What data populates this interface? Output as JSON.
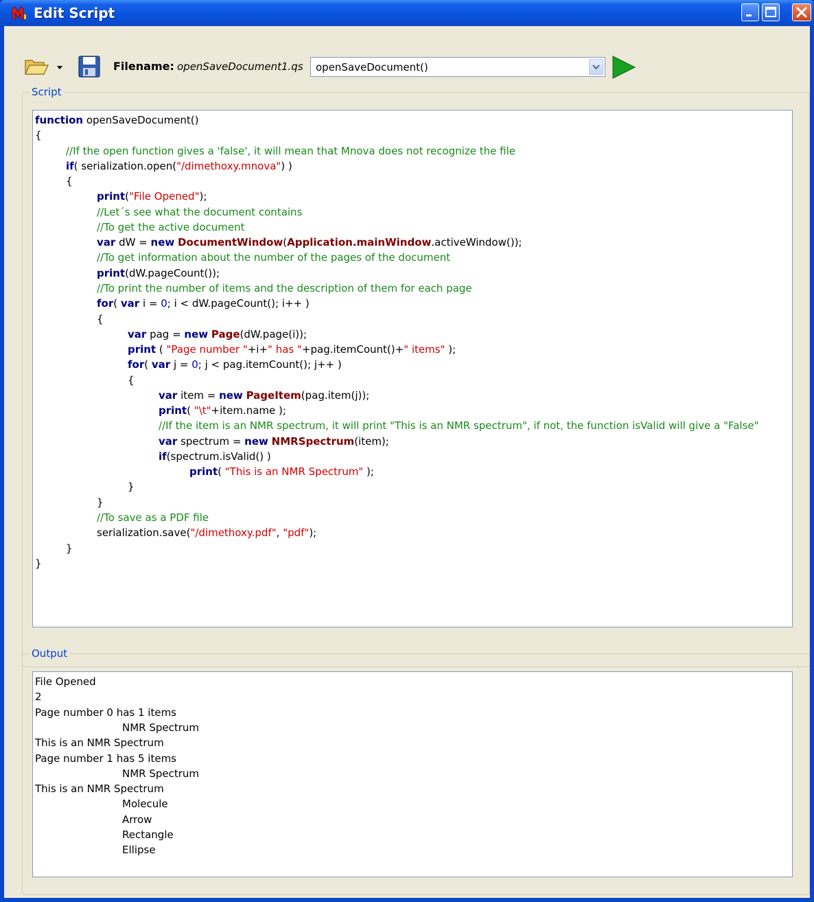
{
  "window": {
    "title": "Edit Script",
    "colors": {
      "titlebar": "#0a52dd",
      "face": "#ece9d8",
      "group_label": "#0046d5"
    }
  },
  "toolbar": {
    "open_icon": "folder-open-icon",
    "dropdown_icon": "chevron-down-icon",
    "save_icon": "floppy-disk-icon",
    "filename_label": "Filename:",
    "filename_value": "openSaveDocument1.qs",
    "function_selected": "openSaveDocument()",
    "run_icon": "play-icon"
  },
  "script": {
    "group_label": "Script",
    "colors": {
      "keyword": "#00007f",
      "class": "#7f0000",
      "string": "#d40000",
      "comment": "#1a8a1a",
      "number": "#0000c0"
    },
    "lines": [
      {
        "indent": 0,
        "tokens": [
          [
            "k",
            "function"
          ],
          [
            "t",
            " openSaveDocument()"
          ]
        ]
      },
      {
        "indent": 0,
        "tokens": [
          [
            "t",
            "{"
          ]
        ]
      },
      {
        "indent": 1,
        "tokens": [
          [
            "c",
            "//If the open function gives a 'false', it will mean that Mnova does not recognize the file"
          ]
        ]
      },
      {
        "indent": 1,
        "tokens": [
          [
            "k",
            "if"
          ],
          [
            "t",
            "( serialization.open("
          ],
          [
            "s",
            "\"/dimethoxy.mnova\""
          ],
          [
            "t",
            ") )"
          ]
        ]
      },
      {
        "indent": 1,
        "tokens": [
          [
            "t",
            "{"
          ]
        ]
      },
      {
        "indent": 2,
        "tokens": [
          [
            "k",
            "print"
          ],
          [
            "t",
            "("
          ],
          [
            "s",
            "\"File Opened\""
          ],
          [
            "t",
            ");"
          ]
        ]
      },
      {
        "indent": 2,
        "tokens": [
          [
            "c",
            "//Let´s see what the document contains"
          ]
        ]
      },
      {
        "indent": 2,
        "tokens": [
          [
            "c",
            "//To get the active document"
          ]
        ]
      },
      {
        "indent": 2,
        "tokens": [
          [
            "k",
            "var"
          ],
          [
            "t",
            " dW = "
          ],
          [
            "k",
            "new"
          ],
          [
            "t",
            " "
          ],
          [
            "x",
            "DocumentWindow"
          ],
          [
            "t",
            "("
          ],
          [
            "x",
            "Application.mainWindow"
          ],
          [
            "t",
            ".activeWindow());"
          ]
        ]
      },
      {
        "indent": 2,
        "tokens": [
          [
            "c",
            "//To get information about the number of the pages of the document"
          ]
        ]
      },
      {
        "indent": 2,
        "tokens": [
          [
            "k",
            "print"
          ],
          [
            "t",
            "(dW.pageCount());"
          ]
        ]
      },
      {
        "indent": 2,
        "tokens": [
          [
            "c",
            "//To print the number of items and the description of them for each page"
          ]
        ]
      },
      {
        "indent": 2,
        "tokens": [
          [
            "k",
            "for"
          ],
          [
            "t",
            "( "
          ],
          [
            "k",
            "var"
          ],
          [
            "t",
            " i = "
          ],
          [
            "n",
            "0"
          ],
          [
            "t",
            "; i < dW.pageCount(); i++ )"
          ]
        ]
      },
      {
        "indent": 2,
        "tokens": [
          [
            "t",
            "{"
          ]
        ]
      },
      {
        "indent": 3,
        "tokens": [
          [
            "k",
            "var"
          ],
          [
            "t",
            " pag = "
          ],
          [
            "k",
            "new"
          ],
          [
            "t",
            " "
          ],
          [
            "x",
            "Page"
          ],
          [
            "t",
            "(dW.page(i));"
          ]
        ]
      },
      {
        "indent": 3,
        "tokens": [
          [
            "k",
            "print"
          ],
          [
            "t",
            " ( "
          ],
          [
            "s",
            "\"Page number \""
          ],
          [
            "t",
            "+i+"
          ],
          [
            "s",
            "\" has \""
          ],
          [
            "t",
            "+pag.itemCount()+"
          ],
          [
            "s",
            "\" items\""
          ],
          [
            "t",
            " );"
          ]
        ]
      },
      {
        "indent": 3,
        "tokens": [
          [
            "k",
            "for"
          ],
          [
            "t",
            "( "
          ],
          [
            "k",
            "var"
          ],
          [
            "t",
            " j = "
          ],
          [
            "n",
            "0"
          ],
          [
            "t",
            "; j < pag.itemCount(); j++ )"
          ]
        ]
      },
      {
        "indent": 3,
        "tokens": [
          [
            "t",
            "{"
          ]
        ]
      },
      {
        "indent": 4,
        "tokens": [
          [
            "k",
            "var"
          ],
          [
            "t",
            " item = "
          ],
          [
            "k",
            "new"
          ],
          [
            "t",
            " "
          ],
          [
            "x",
            "PageItem"
          ],
          [
            "t",
            "(pag.item(j));"
          ]
        ]
      },
      {
        "indent": 4,
        "tokens": [
          [
            "k",
            "print"
          ],
          [
            "t",
            "( "
          ],
          [
            "s",
            "\"\\t\""
          ],
          [
            "t",
            "+item.name );"
          ]
        ]
      },
      {
        "indent": 4,
        "tokens": [
          [
            "c",
            "//If the item is an NMR spectrum, it will print \"This is an NMR spectrum\", if not, the function isValid will give a \"False\""
          ]
        ]
      },
      {
        "indent": 4,
        "tokens": [
          [
            "k",
            "var"
          ],
          [
            "t",
            " spectrum = "
          ],
          [
            "k",
            "new"
          ],
          [
            "t",
            " "
          ],
          [
            "x",
            "NMRSpectrum"
          ],
          [
            "t",
            "(item);"
          ]
        ]
      },
      {
        "indent": 4,
        "tokens": [
          [
            "k",
            "if"
          ],
          [
            "t",
            "(spectrum.isValid() )"
          ]
        ]
      },
      {
        "indent": 5,
        "tokens": [
          [
            "k",
            "print"
          ],
          [
            "t",
            "( "
          ],
          [
            "s",
            "\"This is an NMR Spectrum\""
          ],
          [
            "t",
            " );"
          ]
        ]
      },
      {
        "indent": 3,
        "tokens": [
          [
            "t",
            "}"
          ]
        ]
      },
      {
        "indent": 2,
        "tokens": [
          [
            "t",
            "}"
          ]
        ]
      },
      {
        "indent": 2,
        "tokens": [
          [
            "c",
            "//To save as a PDF file"
          ]
        ]
      },
      {
        "indent": 2,
        "tokens": [
          [
            "t",
            "serialization.save("
          ],
          [
            "s",
            "\"/dimethoxy.pdf\""
          ],
          [
            "t",
            ", "
          ],
          [
            "s",
            "\"pdf\""
          ],
          [
            "t",
            ");"
          ]
        ]
      },
      {
        "indent": 1,
        "tokens": [
          [
            "t",
            "}"
          ]
        ]
      },
      {
        "indent": 0,
        "tokens": [
          [
            "t",
            "}"
          ]
        ]
      }
    ]
  },
  "output": {
    "group_label": "Output",
    "lines": [
      {
        "indent": 0,
        "text": "File Opened"
      },
      {
        "indent": 0,
        "text": "2"
      },
      {
        "indent": 0,
        "text": "Page number 0 has 1 items"
      },
      {
        "indent": 1,
        "text": "NMR Spectrum"
      },
      {
        "indent": 0,
        "text": "This is an NMR Spectrum"
      },
      {
        "indent": 0,
        "text": "Page number 1 has 5 items"
      },
      {
        "indent": 1,
        "text": "NMR Spectrum"
      },
      {
        "indent": 0,
        "text": "This is an NMR Spectrum"
      },
      {
        "indent": 1,
        "text": "Molecule"
      },
      {
        "indent": 1,
        "text": "Arrow"
      },
      {
        "indent": 1,
        "text": "Rectangle"
      },
      {
        "indent": 1,
        "text": "Ellipse"
      }
    ]
  }
}
